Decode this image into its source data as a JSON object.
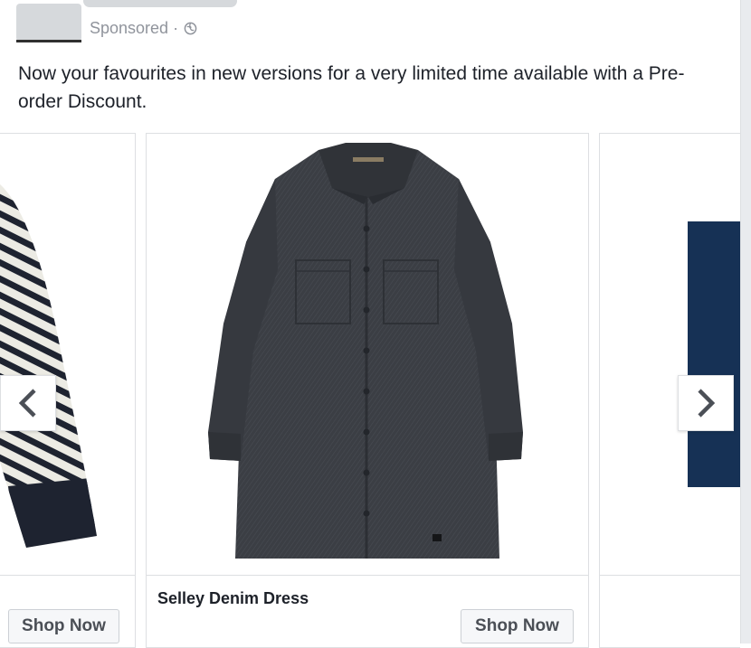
{
  "post": {
    "sponsored_label": "Sponsored · ",
    "text": "Now your favourites in new versions for a very limited time available with a Pre-order Discount."
  },
  "carousel": {
    "cards": [
      {
        "title": "",
        "cta": "Shop Now",
        "image": "striped-sweater"
      },
      {
        "title": "Selley Denim Dress",
        "cta": "Shop Now",
        "image": "denim-shirt-dress"
      },
      {
        "title": "",
        "cta": "",
        "image": "navy-item"
      }
    ],
    "prev_icon": "chevron-left-icon",
    "next_icon": "chevron-right-icon"
  },
  "colors": {
    "denim": "#3b3e44",
    "navy": "#163155",
    "muted_text": "#90949c",
    "button_bg": "#f6f7f9"
  }
}
